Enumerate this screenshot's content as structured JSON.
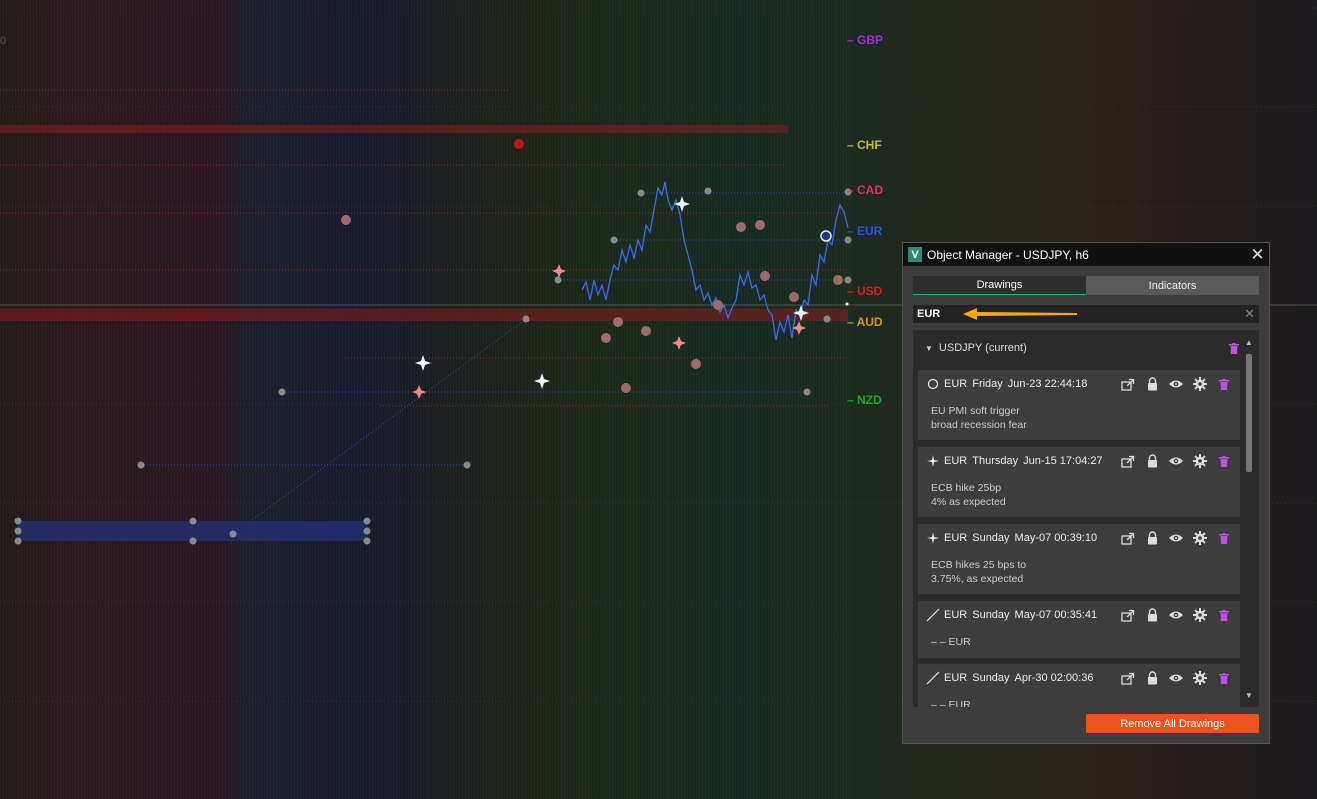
{
  "chart": {
    "currency_labels": [
      {
        "label": "GBP",
        "color": "#9b32e0"
      },
      {
        "label": "CHF",
        "color": "#c8b834"
      },
      {
        "label": "CAD",
        "color": "#e0306f"
      },
      {
        "label": "EUR",
        "color": "#2d52e8"
      },
      {
        "label": "USD",
        "color": "#d42020"
      },
      {
        "label": "AUD",
        "color": "#d49d10"
      },
      {
        "label": "NZD",
        "color": "#23a829"
      }
    ],
    "left_tick": "0"
  },
  "object_manager": {
    "logo": "V",
    "title": "Object Manager - USDJPY, h6",
    "close_icon": "close-icon",
    "tabs": [
      {
        "label": "Drawings",
        "active": true
      },
      {
        "label": "Indicators",
        "active": false
      }
    ],
    "search": {
      "value": "EUR"
    },
    "accent_color": "#e8541c",
    "group": {
      "label": "USDJPY (current)"
    },
    "items": [
      {
        "icon": "circle-icon",
        "currency": "EUR",
        "day": "Friday",
        "datetime": "Jun-23 22:44:18",
        "note1": "EU PMI soft trigger",
        "note2": "broad recession fear"
      },
      {
        "icon": "sparkle-icon",
        "currency": "EUR",
        "day": "Thursday",
        "datetime": "Jun-15 17:04:27",
        "note1": "ECB hike 25bp",
        "note2": "4% as expected"
      },
      {
        "icon": "sparkle-icon",
        "currency": "EUR",
        "day": "Sunday",
        "datetime": "May-07 00:39:10",
        "note1": "ECB hikes 25 bps to",
        "note2": "3.75%, as expected"
      },
      {
        "icon": "trendline-icon",
        "currency": "EUR",
        "day": "Sunday",
        "datetime": "May-07 00:35:41",
        "note1": "– – EUR",
        "note2": ""
      },
      {
        "icon": "trendline-icon",
        "currency": "EUR",
        "day": "Sunday",
        "datetime": "Apr-30 02:00:36",
        "note1": "– – EUR",
        "note2": ""
      }
    ],
    "remove_all_label": "Remove All Drawings"
  }
}
